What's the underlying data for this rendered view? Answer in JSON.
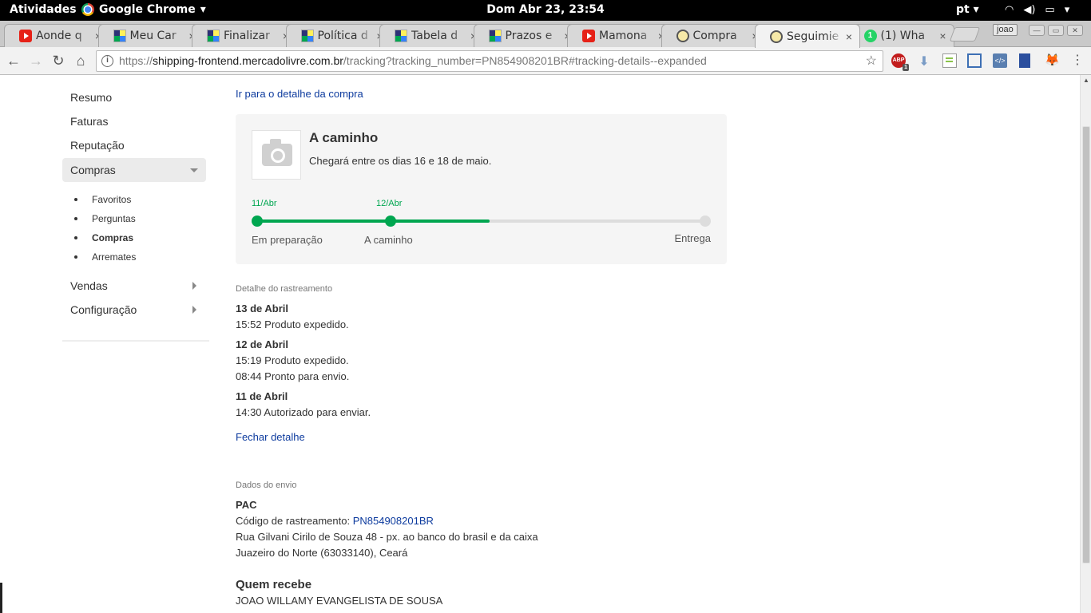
{
  "system_bar": {
    "activities": "Atividades",
    "app_name": "Google Chrome",
    "app_caret": "▾",
    "clock": "Dom Abr 23, 23:54",
    "language": "pt",
    "language_caret": "▾",
    "wifi_glyph": "◠",
    "volume_glyph": "◀)",
    "battery_glyph": "▭",
    "menu_caret": "▾"
  },
  "tabs": [
    {
      "title": "Aonde q",
      "favicon": "youtube-icon",
      "close": "×"
    },
    {
      "title": "Meu Car",
      "favicon": "mercadolivre-icon",
      "close": "×"
    },
    {
      "title": "Finalizar",
      "favicon": "mercadolivre-icon",
      "close": "×"
    },
    {
      "title": "Política d",
      "favicon": "mercadolivre-icon",
      "close": "×"
    },
    {
      "title": "Tabela d",
      "favicon": "mercadolivre-icon",
      "close": "×"
    },
    {
      "title": "Prazos e",
      "favicon": "mercadolivre-icon",
      "close": "×"
    },
    {
      "title": "Mamona",
      "favicon": "youtube-icon",
      "close": "×"
    },
    {
      "title": "Compra",
      "favicon": "handshake-icon",
      "close": "×"
    },
    {
      "title": "Seguimie",
      "favicon": "handshake-icon",
      "close": "×"
    },
    {
      "title": "(1) Wha",
      "favicon": "whatsapp-icon",
      "badge": "1",
      "close": "×"
    }
  ],
  "active_tab_index": 8,
  "window": {
    "user": "joao",
    "minimize": "—",
    "maximize": "▭",
    "close": "✕"
  },
  "toolbar": {
    "back": "←",
    "forward": "→",
    "reload": "↻",
    "home": "⌂",
    "info_glyph": "i",
    "url_scheme": "https://",
    "url_host": "shipping-frontend.mercadolivre.com.br",
    "url_path": "/tracking?tracking_number=PN854908201BR#tracking-details--expanded",
    "star": "☆",
    "extensions": {
      "adblock_label": "ABP",
      "adblock_count": "1",
      "download_glyph": "⬇",
      "code_glyph": "</>",
      "fox_glyph": "🦊",
      "menu_glyph": "⋮"
    }
  },
  "sidebar": {
    "items": [
      {
        "label": "Resumo"
      },
      {
        "label": "Faturas"
      },
      {
        "label": "Reputação"
      },
      {
        "label": "Compras",
        "selected": true,
        "expanded": true
      },
      {
        "label": "Vendas"
      },
      {
        "label": "Configuração"
      }
    ],
    "subitems": [
      {
        "label": "Favoritos"
      },
      {
        "label": "Perguntas"
      },
      {
        "label": "Compras",
        "active": true
      },
      {
        "label": "Arremates"
      }
    ]
  },
  "main": {
    "purchase_link": "Ir para o detalhe da compra",
    "status": {
      "title": "A caminho",
      "eta": "Chegará entre os dias 16 e 18 de maio.",
      "steps": [
        {
          "date": "11/Abr",
          "label": "Em preparação",
          "done": true
        },
        {
          "date": "12/Abr",
          "label": "A caminho",
          "done": true
        },
        {
          "date": "",
          "label": "Entrega",
          "done": false
        }
      ],
      "progress_fraction": 0.52
    },
    "tracking_detail": {
      "label": "Detalhe do rastreamento",
      "days": [
        {
          "date": "13 de Abril",
          "events": [
            "15:52 Produto expedido."
          ]
        },
        {
          "date": "12 de Abril",
          "events": [
            "15:19 Produto expedido.",
            "08:44 Pronto para envio."
          ]
        },
        {
          "date": "11 de Abril",
          "events": [
            "14:30 Autorizado para enviar."
          ]
        }
      ],
      "close_link": "Fechar detalhe"
    },
    "shipping": {
      "label": "Dados do envio",
      "method": "PAC",
      "code_label": "Código de rastreamento: ",
      "code": "PN854908201BR",
      "address_line1": "Rua Gilvani Cirilo de Souza 48 - px. ao banco do brasil e da caixa",
      "address_line2": "Juazeiro do Norte (63033140), Ceará"
    },
    "recipient": {
      "label": "Quem recebe",
      "name": "JOAO WILLAMY EVANGELISTA DE SOUSA"
    }
  },
  "colors": {
    "progress_green": "#00a650",
    "link_blue": "#0d3b9e"
  }
}
